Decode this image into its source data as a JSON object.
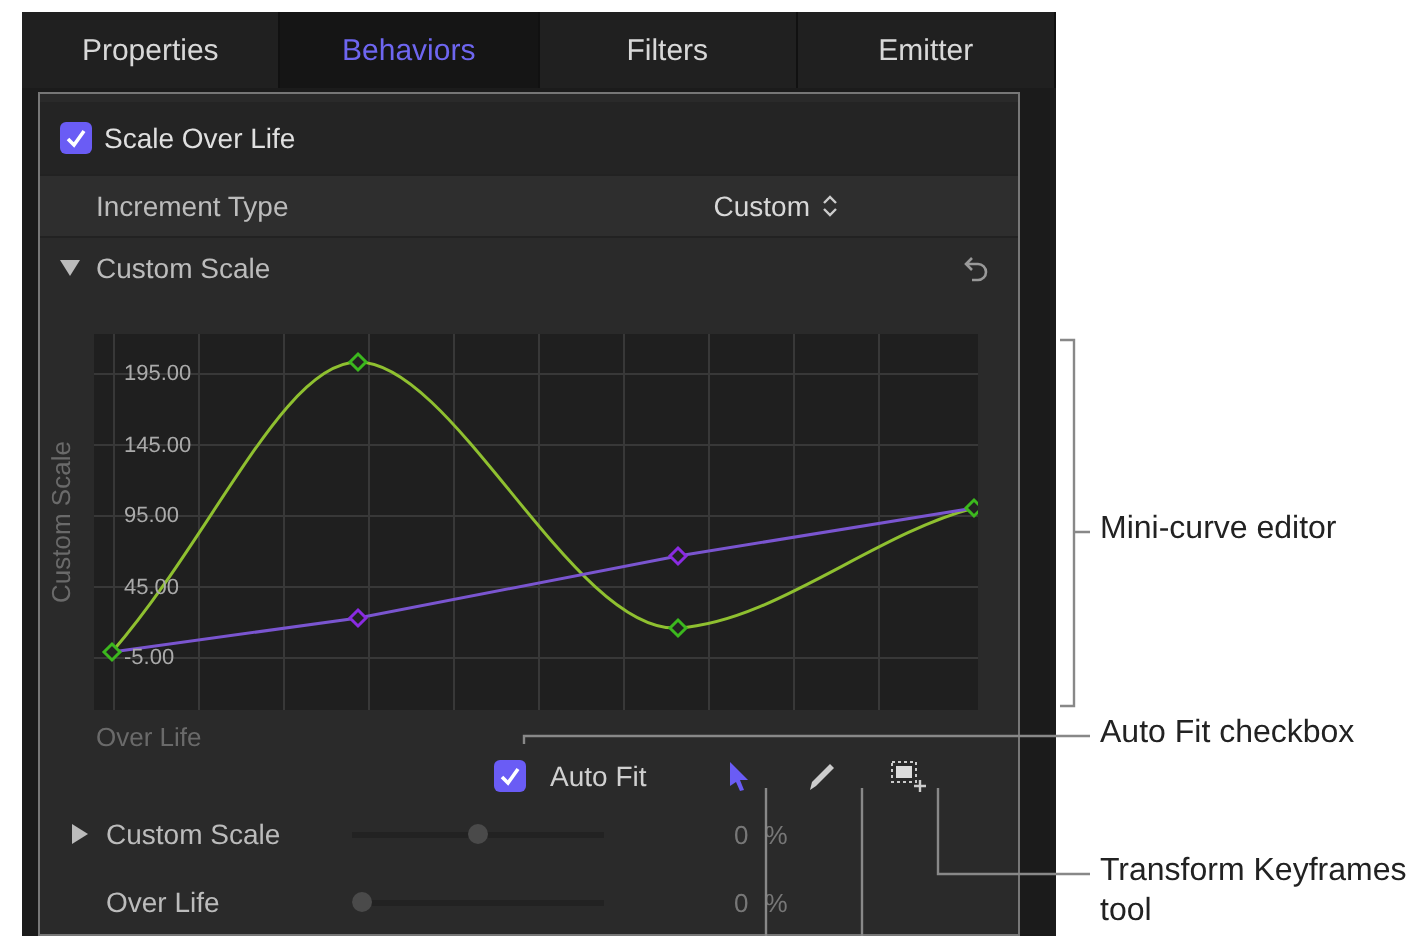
{
  "tabs": [
    {
      "label": "Properties",
      "selected": false
    },
    {
      "label": "Behaviors",
      "selected": true
    },
    {
      "label": "Filters",
      "selected": false
    },
    {
      "label": "Emitter",
      "selected": false
    }
  ],
  "behavior": {
    "label": "Scale Over Life",
    "enabled": true
  },
  "increment_type": {
    "label": "Increment Type",
    "value": "Custom"
  },
  "custom_scale_group": {
    "label": "Custom Scale",
    "expanded": true
  },
  "curve_editor": {
    "y_axis_label": "Custom Scale",
    "y_labels": [
      "195.00",
      "145.00",
      "95.00",
      "45.00",
      "-5.00"
    ],
    "x_axis_label": "Over Life"
  },
  "auto_fit": {
    "label": "Auto Fit",
    "checked": true
  },
  "tools": [
    {
      "kind": "arrow",
      "selected": true
    },
    {
      "kind": "pencil",
      "selected": false
    },
    {
      "kind": "transform",
      "selected": false
    }
  ],
  "parameters": [
    {
      "kind": "group",
      "label": "Custom Scale",
      "level": 0.5,
      "value": "0",
      "unit": "%"
    },
    {
      "kind": "plain",
      "label": "Over Life",
      "level": 0.04,
      "value": "0",
      "unit": "%"
    }
  ],
  "callouts": [
    {
      "kind": "bracket",
      "label": "Mini-curve editor"
    },
    {
      "kind": "checkbox",
      "label": "Auto Fit checkbox"
    },
    {
      "kind": "tool",
      "label": "Transform Keyframes tool"
    }
  ]
}
